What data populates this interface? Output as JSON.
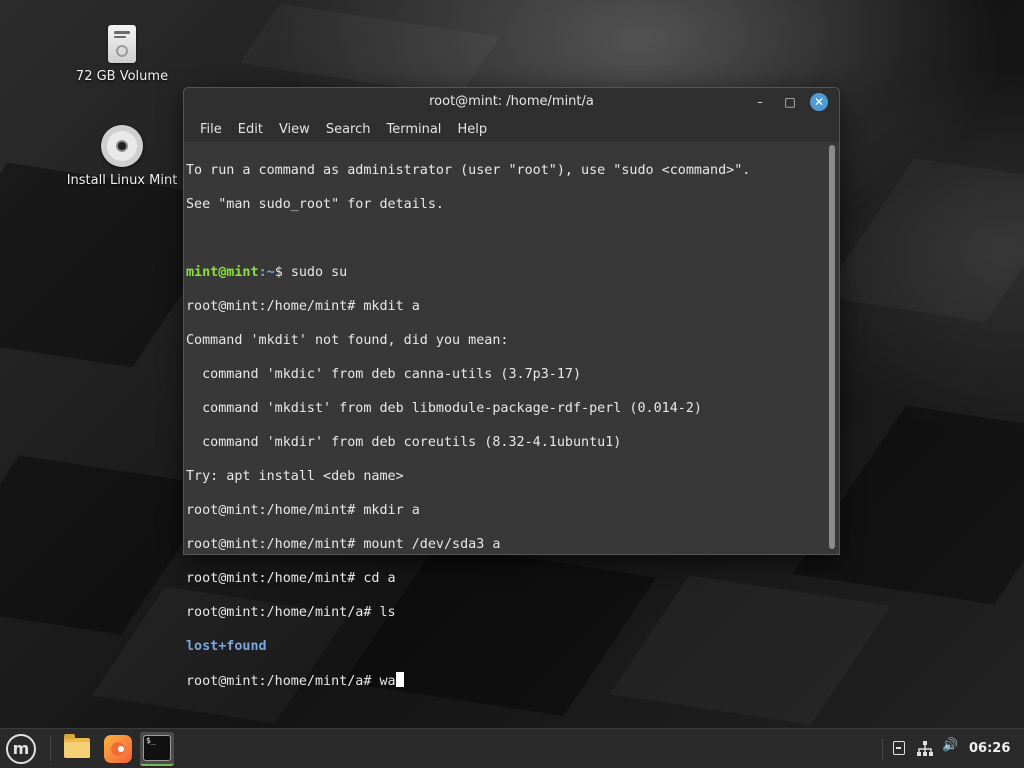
{
  "desktop": {
    "icons": [
      {
        "label": "72 GB Volume",
        "icon": "drive-icon"
      },
      {
        "label": "Install Linux Mint",
        "icon": "cd-icon"
      }
    ]
  },
  "window": {
    "title": "root@mint: /home/mint/a",
    "controls": {
      "minimize": "–",
      "maximize": "□",
      "close": "✕"
    },
    "menu": [
      "File",
      "Edit",
      "View",
      "Search",
      "Terminal",
      "Help"
    ]
  },
  "terminal": {
    "lines": [
      "To run a command as administrator (user \"root\"), use \"sudo <command>\".",
      "See \"man sudo_root\" for details.",
      "",
      "",
      "root@mint:/home/mint# mkdit a",
      "Command 'mkdit' not found, did you mean:",
      "  command 'mkdic' from deb canna-utils (3.7p3-17)",
      "  command 'mkdist' from deb libmodule-package-rdf-perl (0.014-2)",
      "  command 'mkdir' from deb coreutils (8.32-4.1ubuntu1)",
      "Try: apt install <deb name>",
      "root@mint:/home/mint# mkdir a",
      "root@mint:/home/mint# mount /dev/sda3 a",
      "root@mint:/home/mint# cd a",
      "root@mint:/home/mint/a# ls",
      "",
      "root@mint:/home/mint/a# wa"
    ],
    "user_prompt": {
      "user": "mint@mint",
      "path": ":~",
      "symbol": "$ ",
      "command": "sudo su"
    },
    "dir_listing": "lost+found",
    "colors": {
      "user": "#8ae234",
      "path": "#7aa6da",
      "directory": "#79a7e0",
      "background": "#383838",
      "text": "#e8e8e8"
    }
  },
  "taskbar": {
    "start_icon": "mint-logo-icon",
    "apps": [
      {
        "name": "files",
        "icon": "folder-icon"
      },
      {
        "name": "firefox",
        "icon": "firefox-icon"
      },
      {
        "name": "terminal",
        "icon": "terminal-icon",
        "glyph": "$_",
        "active": true
      }
    ],
    "tray": {
      "notes_icon": "notes-icon",
      "network_icon": "network-icon",
      "volume_icon": "volume-icon",
      "volume_glyph": "🔊"
    },
    "clock": "06:26"
  }
}
